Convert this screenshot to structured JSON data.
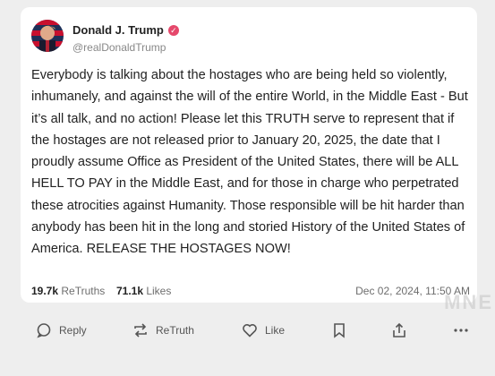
{
  "post": {
    "author_name": "Donald J. Trump",
    "author_handle": "@realDonaldTrump",
    "body": "Everybody is talking about the hostages who are being held so violently, inhumanely, and against the will of the entire World, in the Middle East - But it’s all talk, and no action! Please let this TRUTH serve to represent that if the hostages are not released prior to January 20, 2025, the date that I proudly assume Office as President of the United States, there will be ALL HELL TO PAY in the Middle East, and for those in charge who perpetrated these atrocities against Humanity. Those responsible will be hit harder than anybody has been hit in the long and storied History of the United States of America. RELEASE THE HOSTAGES NOW!",
    "retruths_count": "19.7k",
    "retruths_label": "ReTruths",
    "likes_count": "71.1k",
    "likes_label": "Likes",
    "timestamp": "Dec 02, 2024, 11:50 AM"
  },
  "actions": {
    "reply_label": "Reply",
    "retruth_label": "ReTruth",
    "like_label": "Like"
  },
  "watermark": "MNE",
  "colors": {
    "verified_badge": "#e5486b",
    "page_background": "#eeeeee"
  },
  "icons": [
    "verified-icon",
    "reply-icon",
    "retruth-icon",
    "like-icon",
    "bookmark-icon",
    "share-icon",
    "more-icon"
  ]
}
